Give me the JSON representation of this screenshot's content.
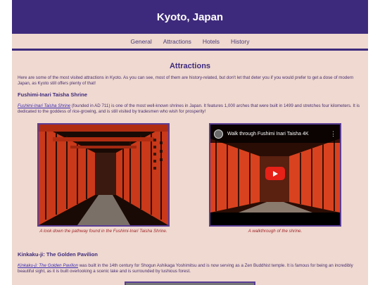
{
  "header": {
    "title": "Kyoto, Japan"
  },
  "nav": {
    "items": [
      "General",
      "Attractions",
      "Hotels",
      "History"
    ]
  },
  "main": {
    "title": "Attractions",
    "intro": "Here are some of the most visited attractions in Kyoto. As you can see, most of them are history-related, but don't let that deter you if you would prefer to get a dose of modern Japan, as Kyoto still offers plenty of that!",
    "fushimi": {
      "heading": "Fushimi-Inari Taisha Shrine",
      "link": "Fushimi-Inari Taisha Shrine",
      "text": " (founded in AD 711) is one of the most well-known shrines in Japan. It features 1,000 arches that were built in 1499 and stretches four kilometers. It is dedicated to the goddess of rice-growing, and is still visited by tradesmen who wish for prosperity!",
      "image_caption": "A look down the pathway found in the Fushimi-Inari Taisha Shrine.",
      "video_title": "Walk through Fushimi Inari Taisha 4K",
      "video_caption": "A walkthrough of the shrine."
    },
    "kinkaku": {
      "heading": "Kinkaku-ji: The Golden Pavilion",
      "link": "Kinkaku-ji: The Golden Pavilion",
      "text": " was built in the 14th century for Shogun Ashikaga Yoshimitsu and is now serving as a Zen Buddhist temple. It is famous for being an incredibly beautiful sight, as it is built overlooking a scenic lake and is surrounded by lushious forest."
    }
  },
  "colors": {
    "header": "#3e2a7c",
    "page": "#efd9d0",
    "caption": "#a0262a",
    "torii": "#d9421f"
  },
  "icons": {
    "video_menu": "more-vert-icon",
    "play": "play-icon"
  }
}
